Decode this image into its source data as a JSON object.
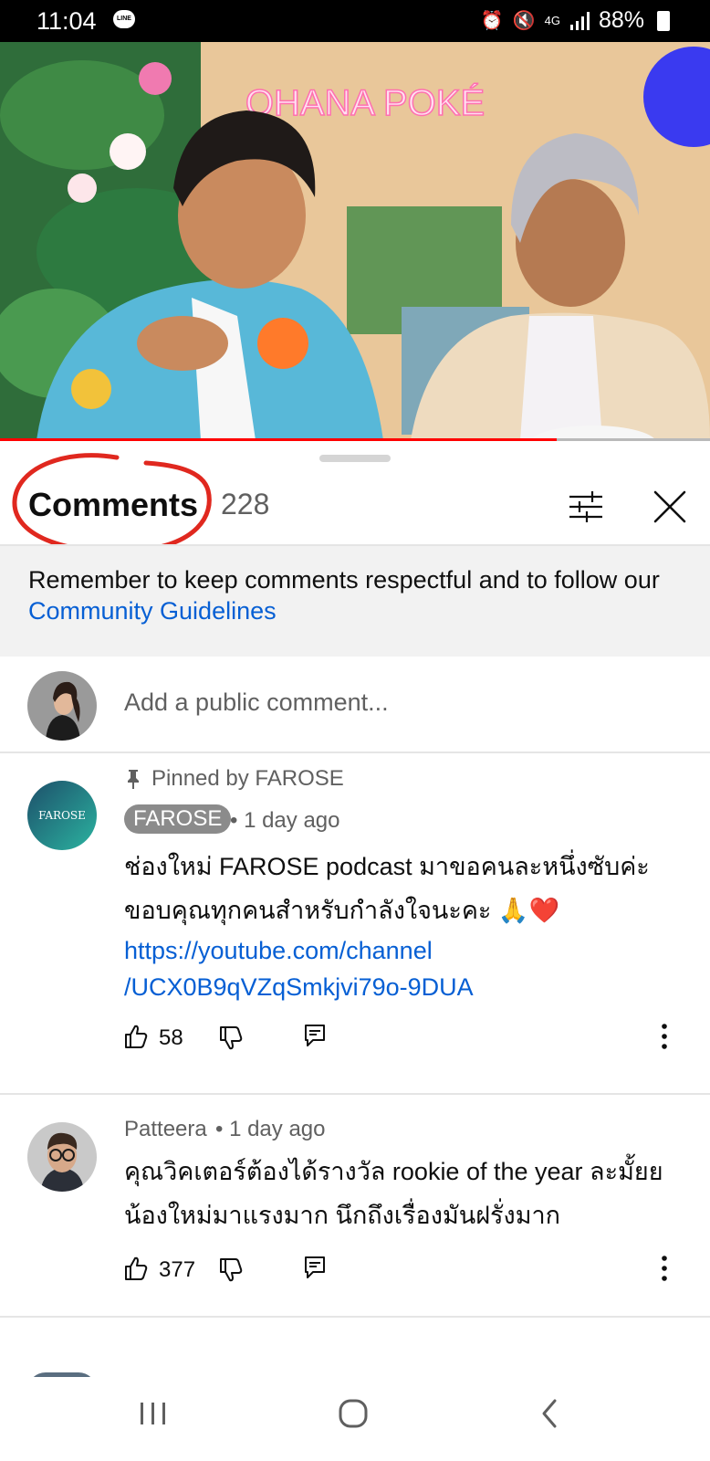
{
  "status_bar": {
    "time": "11:04",
    "line_badge": "LINE",
    "network": "4G",
    "battery": "88%"
  },
  "comments_panel": {
    "title": "Comments",
    "count": "228",
    "guidelines_text": "Remember to keep comments respectful and to follow our",
    "guidelines_link": "Community Guidelines",
    "add_comment_placeholder": "Add a public comment...",
    "annotation_color": "#e0281f"
  },
  "comments": [
    {
      "pinned_label": "Pinned by FAROSE",
      "author": "FAROSE",
      "avatar_text": "FAROSE",
      "time": "• 1 day ago",
      "text_line1": "ช่องใหม่ FAROSE podcast มาขอคนละหนึ่งซับค่ะ",
      "text_line2": "ขอบคุณทุกคนสำหรับกำลังใจนะคะ 🙏❤️",
      "link_line1": "https://youtube.com/channel",
      "link_line2": "/UCX0B9qVZqSmkjvi79o-9DUA",
      "likes": "58"
    },
    {
      "author": "Patteera",
      "time": "• 1 day ago",
      "text_line1": "คุณวิคเตอร์ต้องได้รางวัล rookie of the year  ละมั้ยย",
      "text_line2": "น้องใหม่มาแรงมาก นึกถึงเรื่องมันฝรั่งมาก",
      "likes": "377"
    }
  ],
  "video": {
    "sign_text": "OHANA POKÉ",
    "progress": 0.784
  },
  "colors": {
    "link": "#065fd4",
    "progress": "#ff0000",
    "secondary_text": "#606060"
  }
}
